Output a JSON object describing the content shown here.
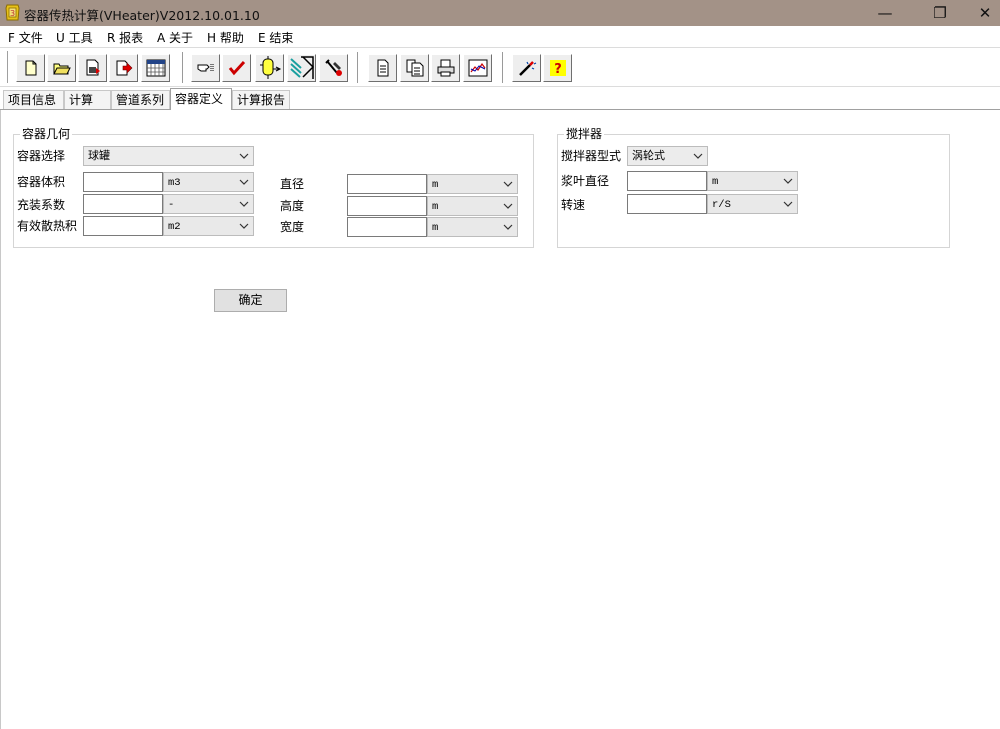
{
  "window": {
    "title": "容器传热计算(VHeater)V2012.10.01.10",
    "minimize": "—",
    "restore": "❐",
    "close": "✕"
  },
  "menu": [
    {
      "label": "F 文件"
    },
    {
      "label": "U 工具"
    },
    {
      "label": "R 报表"
    },
    {
      "label": "A 关于"
    },
    {
      "label": "H 帮助"
    },
    {
      "label": "E 结束"
    }
  ],
  "toolbar": {
    "buttons": [
      {
        "icon": "new-document-icon"
      },
      {
        "icon": "open-folder-icon"
      },
      {
        "icon": "save-icon"
      },
      {
        "icon": "export-icon"
      },
      {
        "icon": "calendar-grid-icon"
      },
      {
        "icon": "pointer-hand-icon"
      },
      {
        "icon": "check-icon"
      },
      {
        "icon": "vessel-icon"
      },
      {
        "icon": "heat-exchanger-icon"
      },
      {
        "icon": "tools-icon"
      },
      {
        "icon": "page-icon"
      },
      {
        "icon": "pages-icon"
      },
      {
        "icon": "print-icon"
      },
      {
        "icon": "chart-icon"
      },
      {
        "icon": "wand-icon"
      },
      {
        "icon": "help-icon"
      }
    ]
  },
  "tabs": [
    {
      "label": "项目信息",
      "active": false
    },
    {
      "label": "计算",
      "active": false
    },
    {
      "label": "管道系列",
      "active": false
    },
    {
      "label": "容器定义",
      "active": true
    },
    {
      "label": "计算报告",
      "active": false
    }
  ],
  "geometry": {
    "title": "容器几何",
    "vessel_select_label": "容器选择",
    "vessel_select_value": "球罐",
    "volume_label": "容器体积",
    "volume_value": "",
    "volume_unit": "m3",
    "fill_label": "充装系数",
    "fill_value": "",
    "fill_unit": "-",
    "area_label": "有效散热积",
    "area_value": "",
    "area_unit": "m2",
    "diameter_label": "直径",
    "diameter_value": "",
    "diameter_unit": "m",
    "height_label": "高度",
    "height_value": "",
    "height_unit": "m",
    "width_label": "宽度",
    "width_value": "",
    "width_unit": "m"
  },
  "agitator": {
    "title": "搅拌器",
    "type_label": "搅拌器型式",
    "type_value": "涡轮式",
    "blade_label": "浆叶直径",
    "blade_value": "",
    "blade_unit": "m",
    "speed_label": "转速",
    "speed_value": "",
    "speed_unit": "r/S"
  },
  "confirm_label": "确定",
  "colors": {
    "titlebar": "#a39287",
    "check_red": "#cc0000",
    "help_yellow": "#ffff00"
  }
}
